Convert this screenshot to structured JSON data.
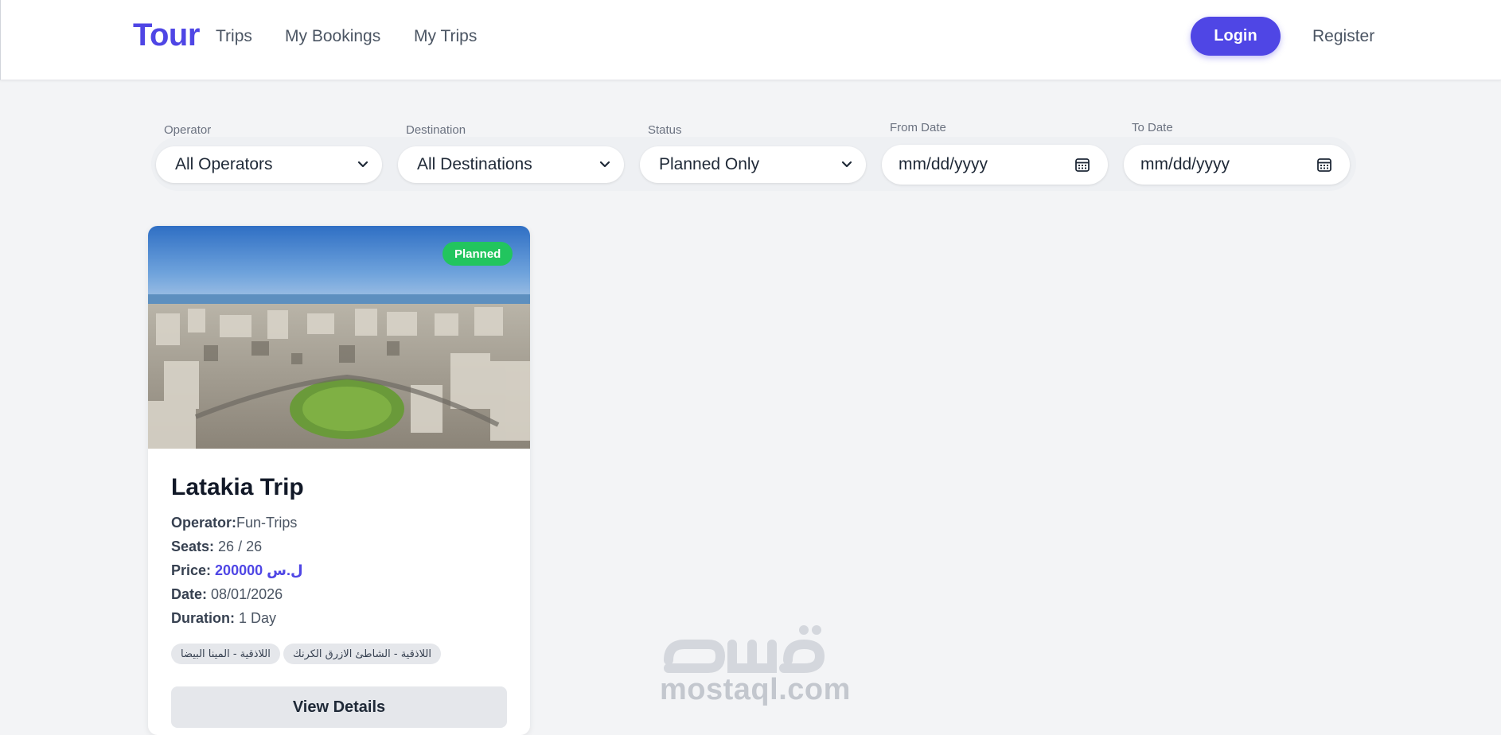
{
  "header": {
    "logo": "Tour",
    "nav": [
      {
        "label": "Trips"
      },
      {
        "label": "My Bookings"
      },
      {
        "label": "My Trips"
      }
    ],
    "login_label": "Login",
    "register_label": "Register"
  },
  "filters": {
    "operator": {
      "label": "Operator",
      "value": "All Operators"
    },
    "destination": {
      "label": "Destination",
      "value": "All Destinations"
    },
    "status": {
      "label": "Status",
      "value": "Planned Only"
    },
    "from_date": {
      "label": "From Date",
      "value": "mm/dd/yyyy"
    },
    "to_date": {
      "label": "To Date",
      "value": "mm/dd/yyyy"
    }
  },
  "trips": [
    {
      "status_badge": "Planned",
      "title": "Latakia Trip",
      "operator_key": "Operator:",
      "operator_value": "Fun-Trips",
      "seats_key": "Seats:",
      "seats_value": "26 / 26",
      "price_key": "Price:",
      "price_value": "200000 ل.س",
      "date_key": "Date:",
      "date_value": "08/01/2026",
      "duration_key": "Duration:",
      "duration_value": "1 Day",
      "tags": [
        "اللاذقية - المينا البيضا",
        "اللاذقية - الشاطئ الازرق الكرنك"
      ],
      "action_label": "View Details"
    }
  ],
  "watermark": {
    "text": "mostaql.com"
  },
  "colors": {
    "accent": "#4f46e5",
    "badge": "#22c55e",
    "background": "#f3f4f6"
  }
}
